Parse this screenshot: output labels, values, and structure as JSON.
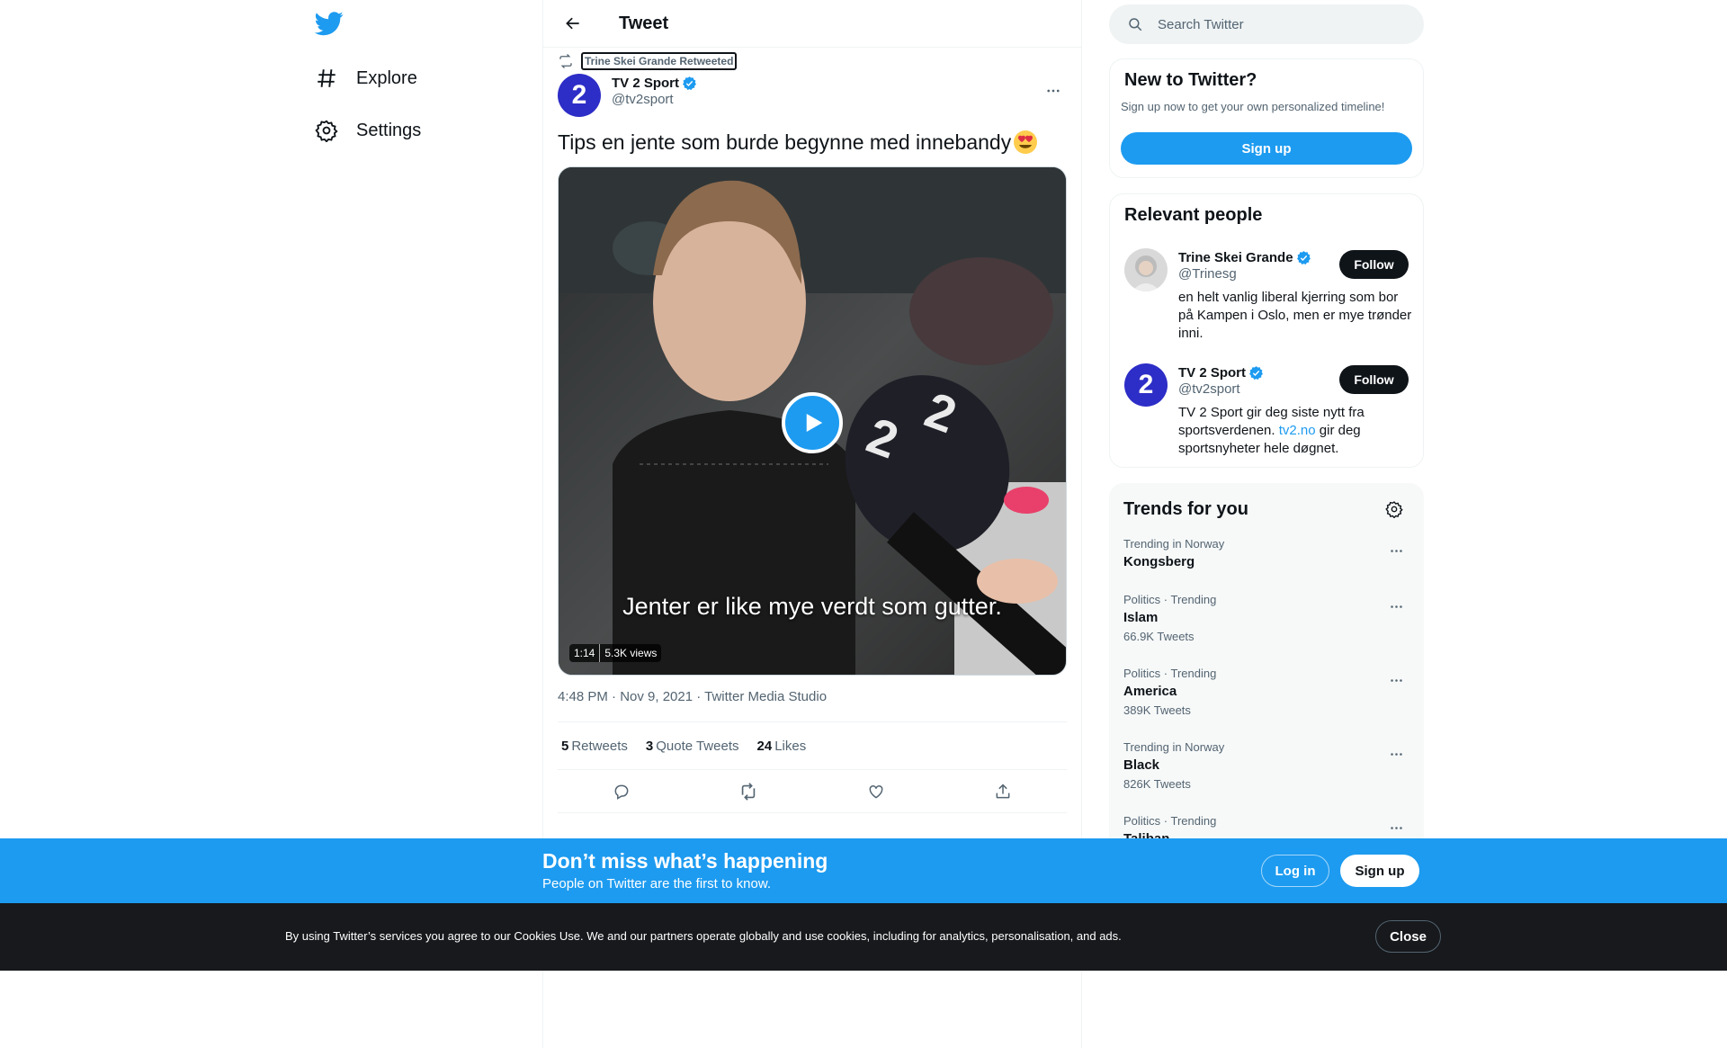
{
  "nav": {
    "items": [
      {
        "label": "Explore",
        "icon": "hashtag-icon"
      },
      {
        "label": "Settings",
        "icon": "gear-icon"
      }
    ]
  },
  "header": {
    "title": "Tweet"
  },
  "tweet": {
    "retweeted_by": "Trine Skei Grande Retweeted",
    "author_name": "TV 2 Sport",
    "author_handle": "@tv2sport",
    "avatar_text": "2",
    "text": "Tips en jente som burde begynne med innebandy",
    "video": {
      "caption": "Jenter er like mye verdt som gutter.",
      "duration": "1:14",
      "views": "5.3K views"
    },
    "timestamp": "4:48 PM · Nov 9, 2021 · Twitter Media Studio",
    "stats": {
      "retweets": {
        "count": "5",
        "label": "Retweets"
      },
      "quotes": {
        "count": "3",
        "label": "Quote Tweets"
      },
      "likes": {
        "count": "24",
        "label": "Likes"
      }
    }
  },
  "search": {
    "placeholder": "Search Twitter"
  },
  "new_to_twitter": {
    "title": "New to Twitter?",
    "subtitle": "Sign up now to get your own personalized timeline!",
    "button": "Sign up"
  },
  "relevant_people": {
    "title": "Relevant people",
    "people": [
      {
        "name": "Trine Skei Grande",
        "handle": "@Trinesg",
        "bio": "en helt vanlig liberal kjerring som bor på Kampen i Oslo, men er mye trønder inni.",
        "follow": "Follow"
      },
      {
        "name": "TV 2 Sport",
        "handle": "@tv2sport",
        "bio_before": "TV 2 Sport gir deg siste nytt fra sportsverdenen. ",
        "bio_link": "tv2.no",
        "bio_after": " gir deg sportsnyheter hele døgnet.",
        "follow": "Follow"
      }
    ]
  },
  "trends": {
    "title": "Trends for you",
    "items": [
      {
        "meta": "Trending in Norway",
        "name": "Kongsberg",
        "count": ""
      },
      {
        "meta": "Politics · Trending",
        "name": "Islam",
        "count": "66.9K Tweets"
      },
      {
        "meta": "Politics · Trending",
        "name": "America",
        "count": "389K Tweets"
      },
      {
        "meta": "Trending in Norway",
        "name": "Black",
        "count": "826K Tweets"
      },
      {
        "meta": "Politics · Trending",
        "name": "Taliban",
        "count": ""
      }
    ]
  },
  "banner": {
    "title": "Don’t miss what’s happening",
    "subtitle": "People on Twitter are the first to know.",
    "login": "Log in",
    "signup": "Sign up"
  },
  "cookie": {
    "text": "By using Twitter’s services you agree to our Cookies Use. We and our partners operate globally and use cookies, including for analytics, personalisation, and ads.",
    "close": "Close"
  },
  "colors": {
    "accent": "#1d9bf0",
    "text_primary": "#0f1419",
    "text_secondary": "#536471",
    "tv2_brand": "#2d2dc7",
    "cookie_bg": "#17191c"
  }
}
